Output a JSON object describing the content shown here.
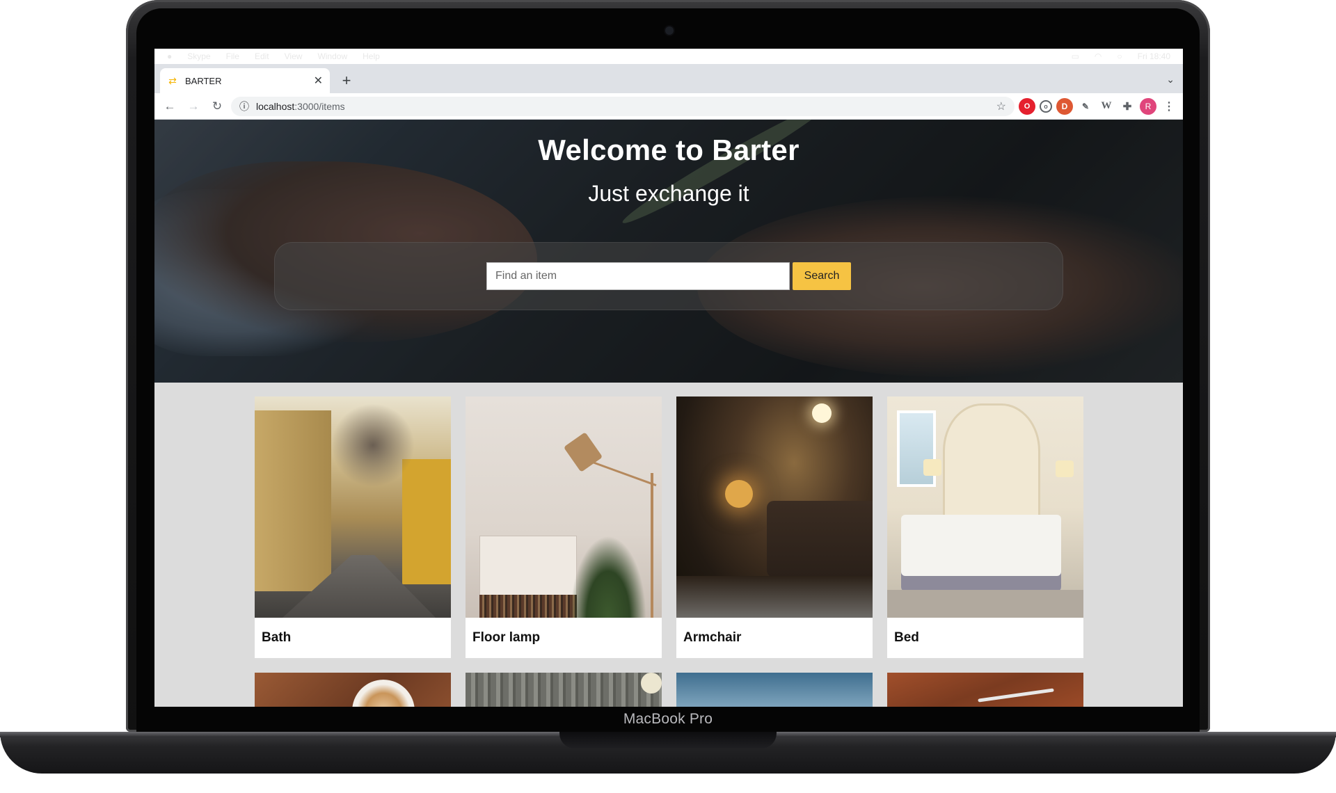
{
  "device": {
    "brand_label": "MacBook Pro"
  },
  "mac_menubar": {
    "items": [
      "Apple",
      "Skype",
      "File",
      "Edit",
      "View",
      "Window",
      "Help"
    ],
    "right_items": [
      "Battery",
      "WiFi",
      "Search",
      "Menu",
      "Fri 18:40"
    ]
  },
  "browser": {
    "tab": {
      "title": "BARTER",
      "favicon": "barter-favicon-icon"
    },
    "address": {
      "host": "localhost",
      "path": ":3000/items"
    },
    "profile_initial": "R",
    "extensions": [
      "opera-icon",
      "ublock-icon",
      "duckduckgo-icon",
      "pen-icon",
      "w-icon",
      "puzzle-icon"
    ]
  },
  "hero": {
    "title": "Welcome to Barter",
    "subtitle": "Just exchange it",
    "search_placeholder": "Find an item",
    "search_button": "Search"
  },
  "items": [
    {
      "name": "Bath",
      "image": "street-photo"
    },
    {
      "name": "Floor lamp",
      "image": "lamp-photo"
    },
    {
      "name": "Armchair",
      "image": "armchair-photo"
    },
    {
      "name": "Bed",
      "image": "bed-photo"
    }
  ],
  "colors": {
    "accent": "#f6c343",
    "page_background": "#dcdcdc",
    "card_background": "#ffffff"
  }
}
